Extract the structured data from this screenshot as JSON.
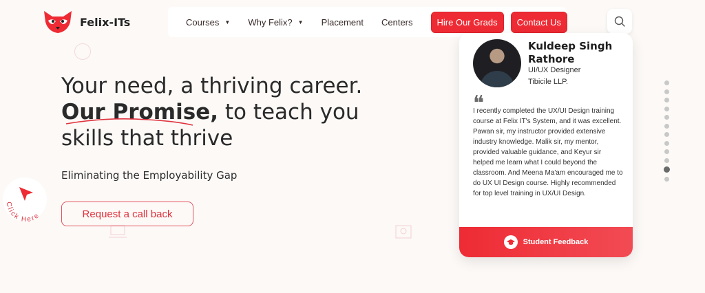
{
  "brand": {
    "name": "Felix-ITs"
  },
  "nav": {
    "items": [
      {
        "label": "Courses",
        "dropdown": true
      },
      {
        "label": "Why Felix?",
        "dropdown": true
      },
      {
        "label": "Placement",
        "dropdown": false
      },
      {
        "label": "Centers",
        "dropdown": false
      }
    ],
    "hire_label": "Hire Our Grads",
    "contact_label": "Contact Us"
  },
  "hero": {
    "line1": "Your need, a thriving career.",
    "promise": "Our Promise,",
    "line2_rest": " to teach you",
    "line3": "skills that thrive",
    "subheading": "Eliminating the Employability Gap",
    "cta_label": "Request a call back",
    "click_here": "Click Here"
  },
  "testimonial": {
    "name": "Kuldeep Singh Rathore",
    "role": "UI/UX Designer",
    "company": "Tibicile LLP.",
    "review": "I recently completed the UX/UI Design training course at Felix IT's System, and it was excellent. Pawan sir, my instructor provided extensive industry knowledge. Malik sir, my mentor, provided valuable guidance, and Keyur sir helped me learn what I could beyond the classroom. And Meena Ma'am encouraged me to do UX UI Design course. Highly recommended for top level training in UX/UI Design.",
    "footer_label": "Student Feedback"
  },
  "pager": {
    "count": 12,
    "active_index": 10
  },
  "colors": {
    "accent": "#ee2b34",
    "background": "#fcf9f7"
  }
}
